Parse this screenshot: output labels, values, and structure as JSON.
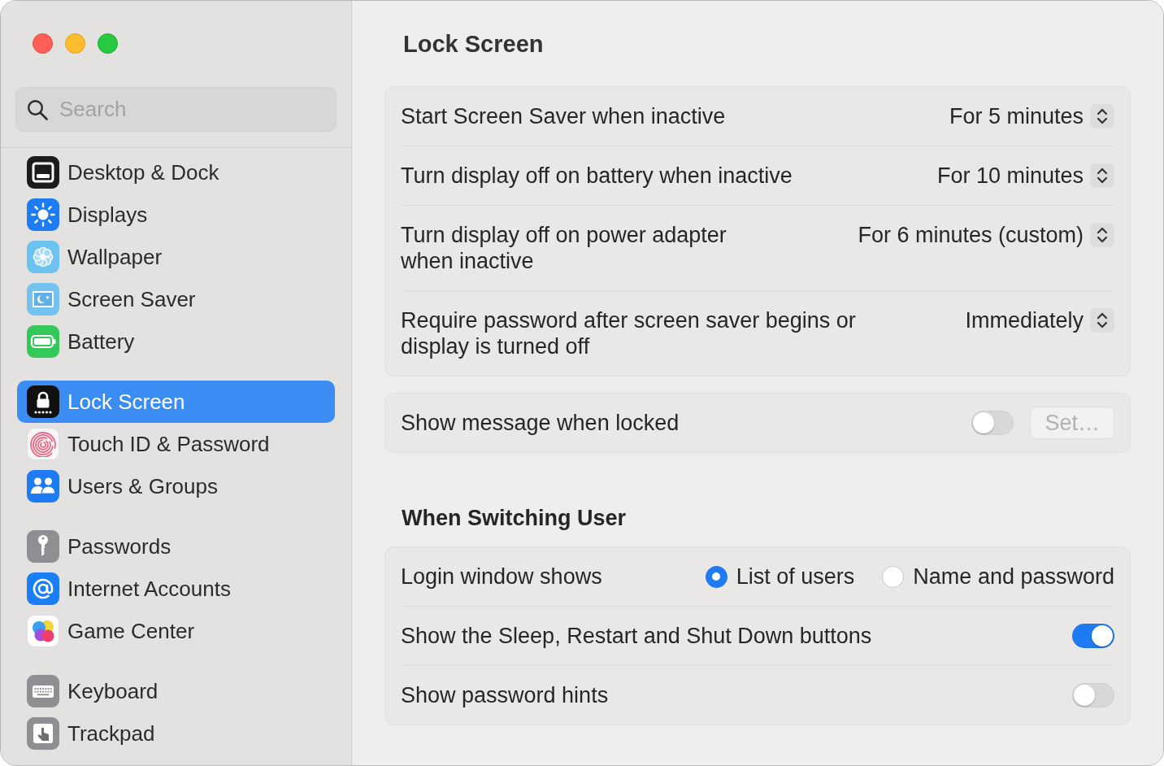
{
  "sidebar": {
    "search": {
      "placeholder": "Search"
    },
    "groups": [
      {
        "items": [
          {
            "label": "Desktop & Dock",
            "selected": false
          },
          {
            "label": "Displays",
            "selected": false
          },
          {
            "label": "Wallpaper",
            "selected": false
          },
          {
            "label": "Screen Saver",
            "selected": false
          },
          {
            "label": "Battery",
            "selected": false
          }
        ]
      },
      {
        "items": [
          {
            "label": "Lock Screen",
            "selected": true
          },
          {
            "label": "Touch ID & Password",
            "selected": false
          },
          {
            "label": "Users & Groups",
            "selected": false
          }
        ]
      },
      {
        "items": [
          {
            "label": "Passwords",
            "selected": false
          },
          {
            "label": "Internet Accounts",
            "selected": false
          },
          {
            "label": "Game Center",
            "selected": false
          }
        ]
      },
      {
        "items": [
          {
            "label": "Keyboard",
            "selected": false
          },
          {
            "label": "Trackpad",
            "selected": false
          }
        ]
      }
    ]
  },
  "content": {
    "title": "Lock Screen",
    "sections": [
      {
        "rows": [
          {
            "kind": "popup",
            "label": "Start Screen Saver when inactive",
            "value": "For 5 minutes"
          },
          {
            "kind": "popup",
            "label": "Turn display off on battery when inactive",
            "value": "For 10 minutes"
          },
          {
            "kind": "popup",
            "label": "Turn display off on power adapter when inactive",
            "value": "For 6 minutes (custom)"
          },
          {
            "kind": "popup",
            "label": "Require password after screen saver begins or display is turned off",
            "value": "Immediately"
          }
        ]
      },
      {
        "rows": [
          {
            "kind": "toggle",
            "label": "Show message when locked",
            "on": false,
            "button": {
              "label": "Set…",
              "disabled": true
            }
          }
        ]
      },
      {
        "heading": "When Switching User",
        "rows": [
          {
            "kind": "radio",
            "label": "Login window shows",
            "options": [
              {
                "label": "List of users",
                "selected": true
              },
              {
                "label": "Name and password",
                "selected": false
              }
            ]
          },
          {
            "kind": "toggle",
            "label": "Show the Sleep, Restart and Shut Down buttons",
            "on": true
          },
          {
            "kind": "toggle",
            "label": "Show password hints",
            "on": false
          }
        ]
      }
    ]
  }
}
